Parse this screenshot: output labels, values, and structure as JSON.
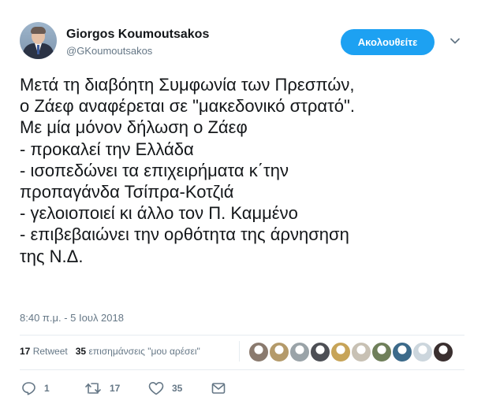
{
  "header": {
    "display_name": "Giorgos Koumoutsakos",
    "screen_name": "@GKoumoutsakos",
    "follow_label": "Ακολουθείτε"
  },
  "tweet": {
    "lines": [
      "Μετά τη διαβόητη Συμφωνία των Πρεσπών,",
      "ο Ζάεφ αναφέρεται σε \"μακεδονικό στρατό\".",
      "Με μία μόνον δήλωση ο Ζάεφ",
      "- προκαλεί την Ελλάδα",
      "- ισοπεδώνει τα επιχειρήματα κ΄την",
      "προπαγάνδα Τσίπρα-Κοτζιά",
      "- γελοιοποιεί κι άλλο τον Π. Καμμένο",
      "- επιβεβαιώνει την ορθότητα της άρνησηση",
      "της Ν.Δ."
    ],
    "timestamp": "8:40 π.μ. - 5 Ιουλ 2018"
  },
  "stats": {
    "retweet_count": "17",
    "retweet_label": "Retweet",
    "like_count": "35",
    "like_label": "επισημάνσεις \"μου αρέσει\""
  },
  "likers": [
    {
      "icon": "avatar-1",
      "color": "#8a7a6e"
    },
    {
      "icon": "avatar-2",
      "color": "#b49a6a"
    },
    {
      "icon": "avatar-3",
      "color": "#9aa3a8"
    },
    {
      "icon": "avatar-4",
      "color": "#4d4f55"
    },
    {
      "icon": "avatar-5",
      "color": "#c7a458"
    },
    {
      "icon": "avatar-6",
      "color": "#c8c1b4"
    },
    {
      "icon": "avatar-7",
      "color": "#6f7f5a"
    },
    {
      "icon": "avatar-8",
      "color": "#3c6a8a"
    },
    {
      "icon": "avatar-9",
      "color": "#ccd6dd"
    },
    {
      "icon": "avatar-10",
      "color": "#3a2f2f"
    }
  ],
  "actions": {
    "reply_count": "1",
    "retweet_count": "17",
    "like_count": "35"
  },
  "colors": {
    "accent": "#1da1f2",
    "text": "#14171a",
    "secondary": "#657786"
  }
}
